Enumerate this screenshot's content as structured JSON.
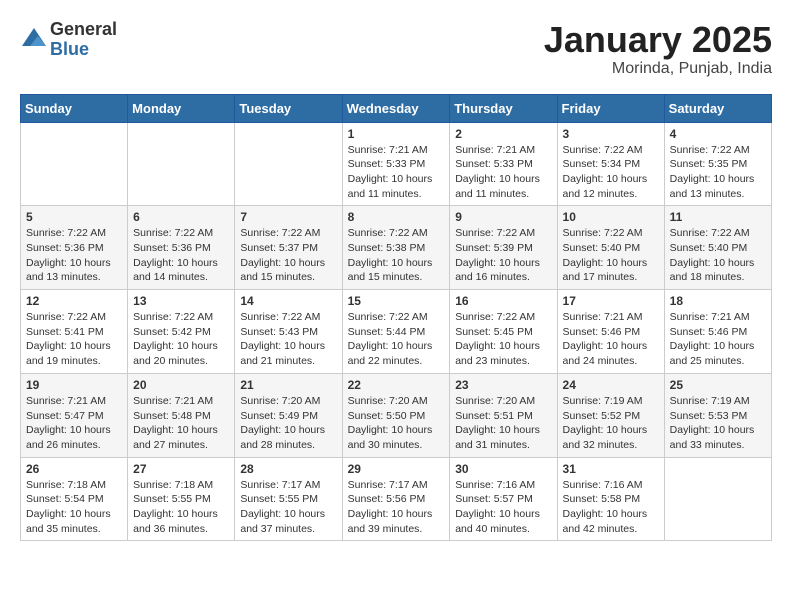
{
  "header": {
    "logo_general": "General",
    "logo_blue": "Blue",
    "month_title": "January 2025",
    "location": "Morinda, Punjab, India"
  },
  "weekdays": [
    "Sunday",
    "Monday",
    "Tuesday",
    "Wednesday",
    "Thursday",
    "Friday",
    "Saturday"
  ],
  "weeks": [
    [
      {
        "day": "",
        "content": ""
      },
      {
        "day": "",
        "content": ""
      },
      {
        "day": "",
        "content": ""
      },
      {
        "day": "1",
        "content": "Sunrise: 7:21 AM\nSunset: 5:33 PM\nDaylight: 10 hours\nand 11 minutes."
      },
      {
        "day": "2",
        "content": "Sunrise: 7:21 AM\nSunset: 5:33 PM\nDaylight: 10 hours\nand 11 minutes."
      },
      {
        "day": "3",
        "content": "Sunrise: 7:22 AM\nSunset: 5:34 PM\nDaylight: 10 hours\nand 12 minutes."
      },
      {
        "day": "4",
        "content": "Sunrise: 7:22 AM\nSunset: 5:35 PM\nDaylight: 10 hours\nand 13 minutes."
      }
    ],
    [
      {
        "day": "5",
        "content": "Sunrise: 7:22 AM\nSunset: 5:36 PM\nDaylight: 10 hours\nand 13 minutes."
      },
      {
        "day": "6",
        "content": "Sunrise: 7:22 AM\nSunset: 5:36 PM\nDaylight: 10 hours\nand 14 minutes."
      },
      {
        "day": "7",
        "content": "Sunrise: 7:22 AM\nSunset: 5:37 PM\nDaylight: 10 hours\nand 15 minutes."
      },
      {
        "day": "8",
        "content": "Sunrise: 7:22 AM\nSunset: 5:38 PM\nDaylight: 10 hours\nand 15 minutes."
      },
      {
        "day": "9",
        "content": "Sunrise: 7:22 AM\nSunset: 5:39 PM\nDaylight: 10 hours\nand 16 minutes."
      },
      {
        "day": "10",
        "content": "Sunrise: 7:22 AM\nSunset: 5:40 PM\nDaylight: 10 hours\nand 17 minutes."
      },
      {
        "day": "11",
        "content": "Sunrise: 7:22 AM\nSunset: 5:40 PM\nDaylight: 10 hours\nand 18 minutes."
      }
    ],
    [
      {
        "day": "12",
        "content": "Sunrise: 7:22 AM\nSunset: 5:41 PM\nDaylight: 10 hours\nand 19 minutes."
      },
      {
        "day": "13",
        "content": "Sunrise: 7:22 AM\nSunset: 5:42 PM\nDaylight: 10 hours\nand 20 minutes."
      },
      {
        "day": "14",
        "content": "Sunrise: 7:22 AM\nSunset: 5:43 PM\nDaylight: 10 hours\nand 21 minutes."
      },
      {
        "day": "15",
        "content": "Sunrise: 7:22 AM\nSunset: 5:44 PM\nDaylight: 10 hours\nand 22 minutes."
      },
      {
        "day": "16",
        "content": "Sunrise: 7:22 AM\nSunset: 5:45 PM\nDaylight: 10 hours\nand 23 minutes."
      },
      {
        "day": "17",
        "content": "Sunrise: 7:21 AM\nSunset: 5:46 PM\nDaylight: 10 hours\nand 24 minutes."
      },
      {
        "day": "18",
        "content": "Sunrise: 7:21 AM\nSunset: 5:46 PM\nDaylight: 10 hours\nand 25 minutes."
      }
    ],
    [
      {
        "day": "19",
        "content": "Sunrise: 7:21 AM\nSunset: 5:47 PM\nDaylight: 10 hours\nand 26 minutes."
      },
      {
        "day": "20",
        "content": "Sunrise: 7:21 AM\nSunset: 5:48 PM\nDaylight: 10 hours\nand 27 minutes."
      },
      {
        "day": "21",
        "content": "Sunrise: 7:20 AM\nSunset: 5:49 PM\nDaylight: 10 hours\nand 28 minutes."
      },
      {
        "day": "22",
        "content": "Sunrise: 7:20 AM\nSunset: 5:50 PM\nDaylight: 10 hours\nand 30 minutes."
      },
      {
        "day": "23",
        "content": "Sunrise: 7:20 AM\nSunset: 5:51 PM\nDaylight: 10 hours\nand 31 minutes."
      },
      {
        "day": "24",
        "content": "Sunrise: 7:19 AM\nSunset: 5:52 PM\nDaylight: 10 hours\nand 32 minutes."
      },
      {
        "day": "25",
        "content": "Sunrise: 7:19 AM\nSunset: 5:53 PM\nDaylight: 10 hours\nand 33 minutes."
      }
    ],
    [
      {
        "day": "26",
        "content": "Sunrise: 7:18 AM\nSunset: 5:54 PM\nDaylight: 10 hours\nand 35 minutes."
      },
      {
        "day": "27",
        "content": "Sunrise: 7:18 AM\nSunset: 5:55 PM\nDaylight: 10 hours\nand 36 minutes."
      },
      {
        "day": "28",
        "content": "Sunrise: 7:17 AM\nSunset: 5:55 PM\nDaylight: 10 hours\nand 37 minutes."
      },
      {
        "day": "29",
        "content": "Sunrise: 7:17 AM\nSunset: 5:56 PM\nDaylight: 10 hours\nand 39 minutes."
      },
      {
        "day": "30",
        "content": "Sunrise: 7:16 AM\nSunset: 5:57 PM\nDaylight: 10 hours\nand 40 minutes."
      },
      {
        "day": "31",
        "content": "Sunrise: 7:16 AM\nSunset: 5:58 PM\nDaylight: 10 hours\nand 42 minutes."
      },
      {
        "day": "",
        "content": ""
      }
    ]
  ]
}
